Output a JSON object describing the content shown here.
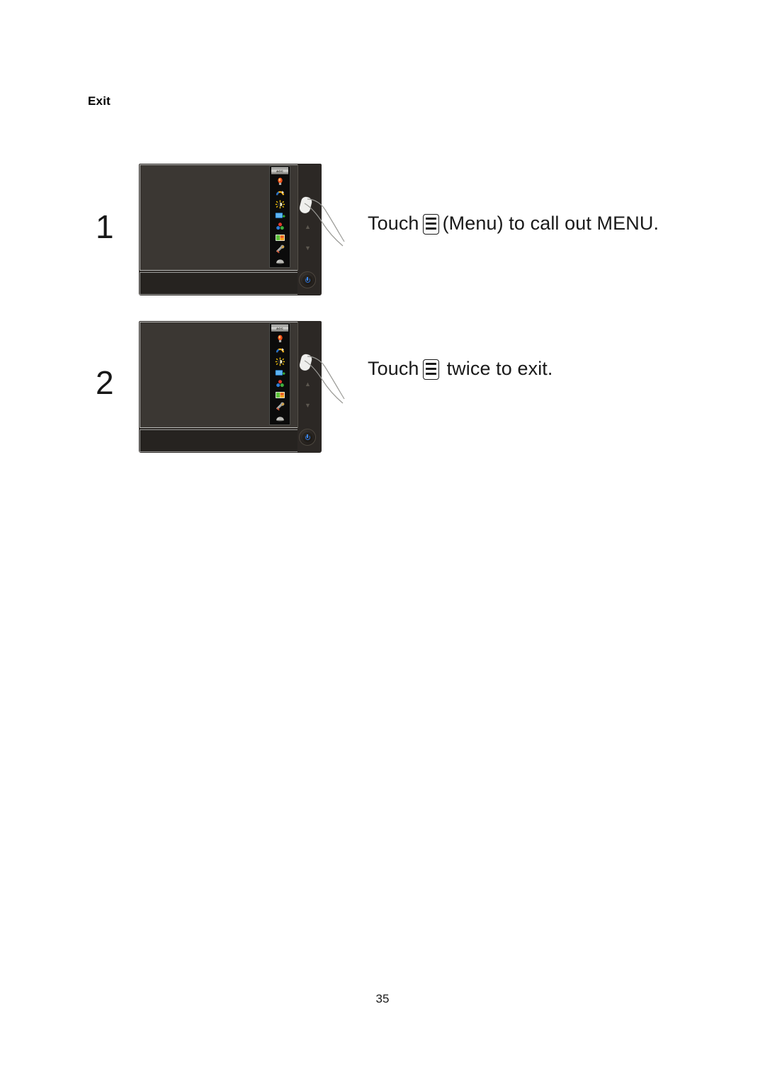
{
  "document": {
    "section_title": "Exit",
    "page_number": "35"
  },
  "steps": [
    {
      "number": "1",
      "instruction_prefix": "Touch",
      "icon": "menu-icon",
      "instruction_suffix": "(Menu) to  call out MENU.",
      "monitor": {
        "brand_logo": "AOC",
        "osd_icons": [
          "luminance-icon",
          "image-setup-icon",
          "color-setup-icon",
          "picture-boost-icon",
          "osd-setup-icon",
          "extra-icon",
          "reset-tools-icon",
          "exit-icon"
        ],
        "buttons": {
          "menu_button": "menu-touch-button",
          "nav_up": "▲",
          "nav_down": "▼",
          "power_button": "power-icon"
        }
      }
    },
    {
      "number": "2",
      "instruction_prefix": "Touch",
      "icon": "menu-icon",
      "instruction_suffix": "twice to exit.",
      "monitor": {
        "brand_logo": "AOC",
        "osd_icons": [
          "luminance-icon",
          "image-setup-icon",
          "color-setup-icon",
          "picture-boost-icon",
          "osd-setup-icon",
          "extra-icon",
          "reset-tools-icon",
          "exit-icon"
        ],
        "buttons": {
          "menu_button": "menu-touch-button",
          "nav_up": "▲",
          "nav_down": "▼",
          "power_button": "power-icon"
        }
      }
    }
  ],
  "colors": {
    "monitor_body": "#2c2825",
    "screen": "#3b3733",
    "bottom_bezel": "#262320",
    "osd_background": "#0b0b0b",
    "power_led": "#3b88ef",
    "text": "#1a1a1a"
  }
}
